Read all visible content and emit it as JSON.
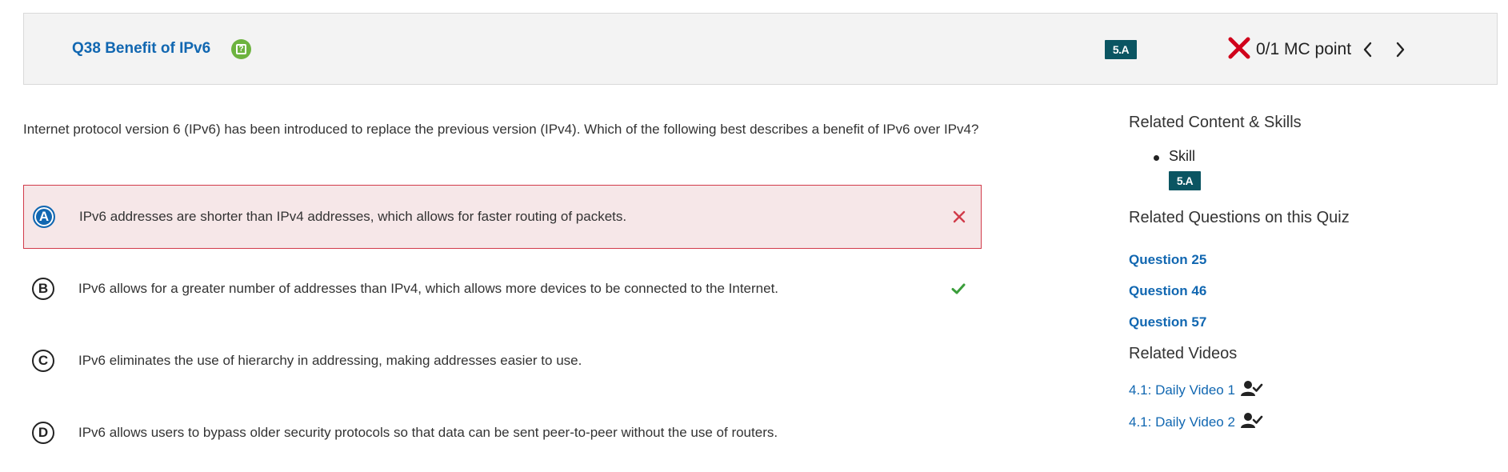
{
  "header": {
    "question_title": "Q38 Benefit of IPv6",
    "help_icon_glyph": "?",
    "skill_badge": "5.A",
    "score_text": "0/1 MC point",
    "colors": {
      "link": "#1167b1",
      "help": "#6db33f",
      "badge": "#0b5562",
      "wrong": "#d0021b"
    }
  },
  "question": {
    "stem": "Internet protocol version 6 (IPv6) has been introduced to replace the previous version (IPv4). Which of the following best describes a benefit of IPv6 over IPv4?",
    "options": [
      {
        "letter": "A",
        "text": "IPv6 addresses are shorter than IPv4 addresses, which allows for faster routing of packets.",
        "status": "selected-incorrect",
        "mark": "x-icon"
      },
      {
        "letter": "B",
        "text": "IPv6 allows for a greater number of addresses than IPv4, which allows more devices to be connected to the Internet.",
        "status": "correct",
        "mark": "check-icon"
      },
      {
        "letter": "C",
        "text": "IPv6 eliminates the use of hierarchy in addressing, making addresses easier to use.",
        "status": "none",
        "mark": ""
      },
      {
        "letter": "D",
        "text": "IPv6 allows users to bypass older security protocols so that data can be sent peer-to-peer without the use of routers.",
        "status": "none",
        "mark": ""
      }
    ]
  },
  "sidebar": {
    "related_content_heading": "Related Content & Skills",
    "skill_label": "Skill",
    "skill_badge": "5.A",
    "related_questions_heading": "Related Questions on this Quiz",
    "related_questions": [
      "Question 25",
      "Question 46",
      "Question 57"
    ],
    "related_videos_heading": "Related Videos",
    "related_videos": [
      "4.1: Daily Video 1",
      "4.1: Daily Video 2"
    ]
  }
}
